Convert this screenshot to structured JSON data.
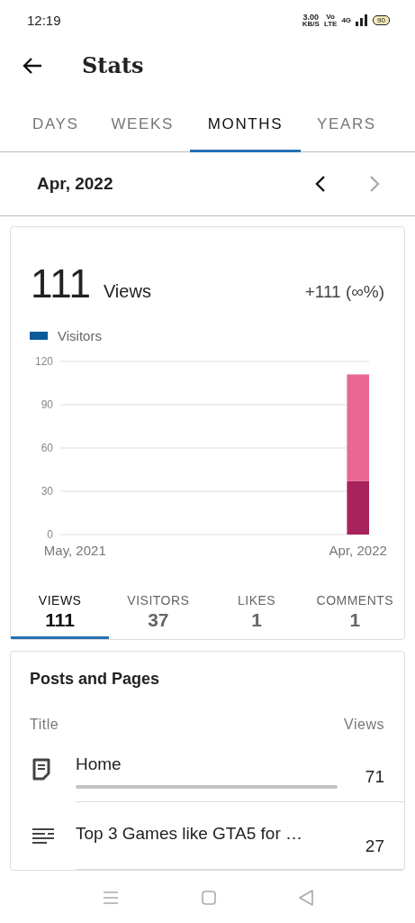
{
  "status_bar": {
    "time": "12:19",
    "speed": "3.00",
    "speed_unit": "KB/S",
    "volte_top": "Vo",
    "volte_bottom": "LTE",
    "network": "4G",
    "battery": "90"
  },
  "header": {
    "title": "Stats"
  },
  "tabs": [
    {
      "label": "DAYS",
      "selected": false
    },
    {
      "label": "WEEKS",
      "selected": false
    },
    {
      "label": "MONTHS",
      "selected": true
    },
    {
      "label": "YEARS",
      "selected": false
    }
  ],
  "period": {
    "label": "Apr, 2022",
    "prev_enabled": true,
    "next_enabled": false
  },
  "overview": {
    "total": "111",
    "unit": "Views",
    "change": "+111 (∞%)",
    "legend": "Visitors",
    "chart_data": {
      "type": "bar",
      "stacked": true,
      "grid": true,
      "categories": [
        "May, 2021",
        null,
        null,
        null,
        null,
        null,
        null,
        null,
        null,
        null,
        null,
        "Apr, 2022"
      ],
      "ylim": [
        0,
        120
      ],
      "yticks": [
        0,
        30,
        60,
        90,
        120
      ],
      "series": [
        {
          "color": "#a8225c",
          "values": [
            0,
            0,
            0,
            0,
            0,
            0,
            0,
            0,
            0,
            0,
            0,
            37
          ]
        },
        {
          "color": "#e96893",
          "values": [
            0,
            0,
            0,
            0,
            0,
            0,
            0,
            0,
            0,
            0,
            0,
            74
          ]
        }
      ]
    },
    "metrics": [
      {
        "label": "VIEWS",
        "value": "111",
        "selected": true
      },
      {
        "label": "VISITORS",
        "value": "37",
        "selected": false
      },
      {
        "label": "LIKES",
        "value": "1",
        "selected": false
      },
      {
        "label": "COMMENTS",
        "value": "1",
        "selected": false
      }
    ]
  },
  "posts": {
    "title": "Posts and Pages",
    "col_title": "Title",
    "col_views": "Views",
    "rows": [
      {
        "kind": "page",
        "title": "Home",
        "views": "71"
      },
      {
        "kind": "post",
        "title": "Top 3 Games like GTA5 for …",
        "views": "27"
      }
    ]
  }
}
